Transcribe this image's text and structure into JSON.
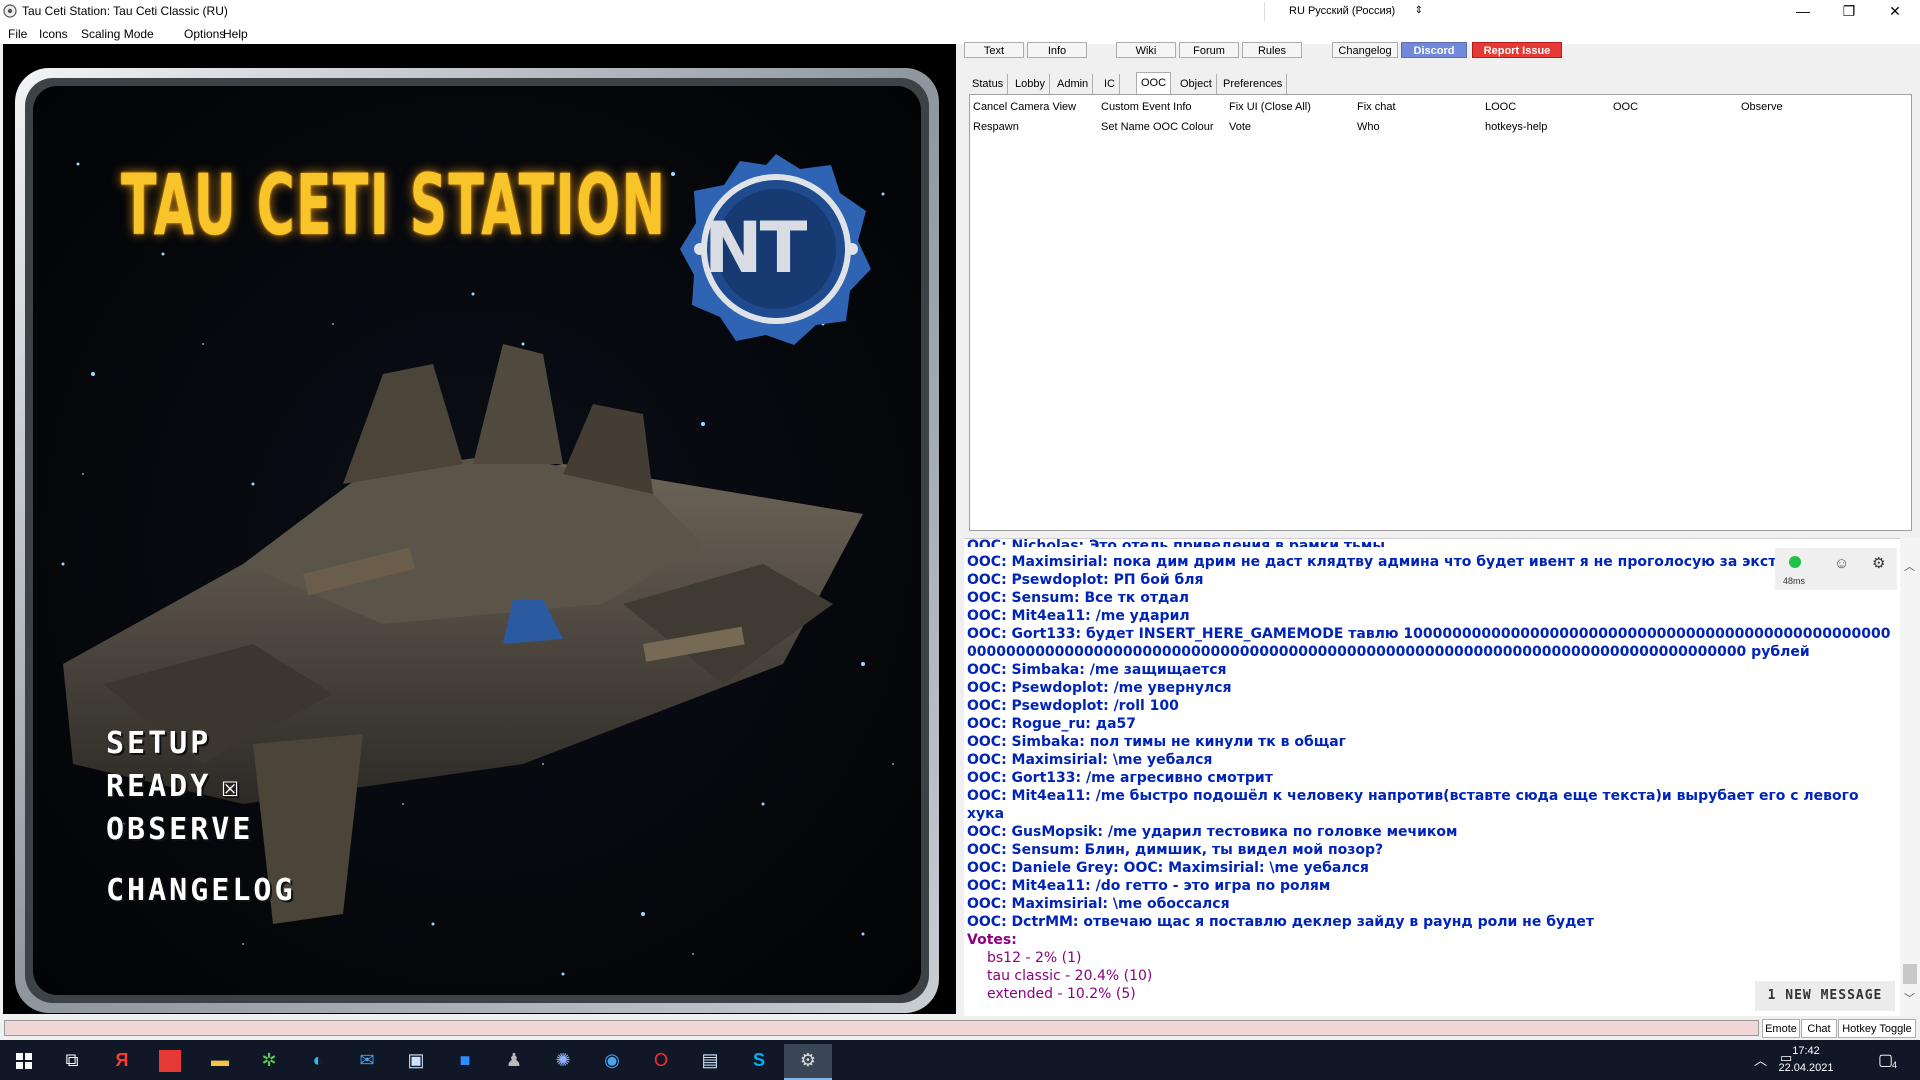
{
  "window": {
    "title": "Tau Ceti Station: Tau Ceti Classic (RU)",
    "language": "RU Русский (Россия)",
    "minimize": "—",
    "maximize": "❐",
    "close": "✕"
  },
  "menu": {
    "file": "File",
    "icons": "Icons",
    "scaling": "Scaling Mode",
    "options": "Options",
    "help": "Help"
  },
  "game": {
    "title": "TAU CETI STATION",
    "logo": "NT",
    "menu": {
      "setup": "SETUP",
      "ready": "READY",
      "ready_box": "☒",
      "observe": "OBSERVE",
      "changelog": "CHANGELOG"
    }
  },
  "top_buttons": {
    "text": "Text",
    "info": "Info",
    "wiki": "Wiki",
    "forum": "Forum",
    "rules": "Rules",
    "changelog": "Changelog",
    "discord": "Discord",
    "report": "Report Issue"
  },
  "panel_tabs": [
    "Status",
    "Lobby",
    "Admin",
    "IC",
    "OOC",
    "Object",
    "Preferences"
  ],
  "verbs": [
    "Cancel Camera View",
    "Custom Event Info",
    "Fix UI (Close All)",
    "Fix chat",
    "LOOC",
    "OOC",
    "Observe",
    "Respawn",
    "Set Name OOC Colour",
    "Vote",
    "Who",
    "hotkeys-help"
  ],
  "chat": {
    "partial_top": "OOC: Nicholas: Это отель приведения в рамки тьмы",
    "lines": [
      "OOC: Maximsirial: пока дим дрим не даст клядтву админа что будет ивент я не проголосую за эксту",
      "OOC: Psewdoplot: РП бой бля",
      "OOC: Sensum: Все тк отдал",
      "OOC: Mit4ea11: /me ударил",
      "OOC: Gort133: будет INSERT_HERE_GAMEMODE тавлю 1000000000000000000000000000000000000000000000000000000000000000000000000000000000000000000000000000000000000000000000000000000000 рублей",
      "OOC: Simbaka: /me защищается",
      "OOC: Psewdoplot: /me увернулся",
      "OOC: Psewdoplot: /roll 100",
      "OOC: Rogue_ru: да57",
      "OOC: Simbaka: пол тимы не кинули тк в общаг",
      "OOC: Maximsirial: \\me уебался",
      "OOC: Gort133: /me агресивно смотрит",
      "OOC: Mit4ea11: /me быстро подошёл к человеку напротив(вставте сюда еще текста)и вырубает его с левого хука",
      "OOC: GusMopsik: /me ударил тестовика по головке мечиком",
      "OOC: Sensum: Блин, димшик, ты видел мой позор?",
      "OOC: Daniele Grey: OOC: Maximsirial: \\me уебался",
      "OOC: Mit4ea11: /do гетто - это игра по ролям",
      "OOC: Maximsirial: \\me обоссался",
      "OOC: DctrMM: отвечаю щас я поставлю деклер зайду в раунд роли не будет"
    ],
    "votes_label": "Votes:",
    "votes": [
      "bs12 - 2% (1)",
      "tau classic - 20.4% (10)",
      "extended - 10.2% (5)"
    ],
    "ping": "48ms",
    "new_message": "1 NEW MESSAGE"
  },
  "input_bar": {
    "emote": "Emote",
    "chat": "Chat",
    "hotkey": "Hotkey Toggle"
  },
  "taskbar": {
    "time": "17:42",
    "date": "22.04.2021",
    "notifications": "4"
  }
}
